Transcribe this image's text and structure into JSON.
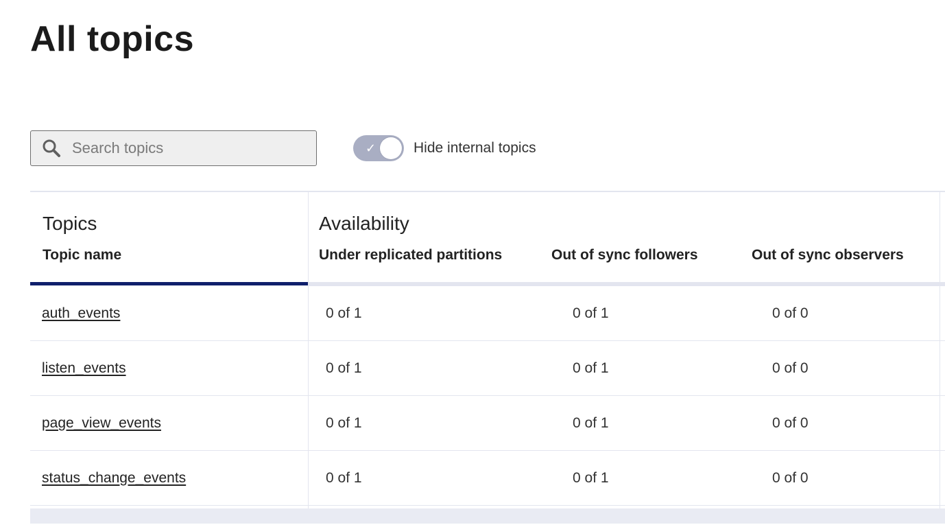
{
  "page": {
    "title": "All topics"
  },
  "search": {
    "placeholder": "Search topics",
    "value": ""
  },
  "toggle": {
    "label": "Hide internal topics",
    "checked": true
  },
  "table": {
    "groups": [
      {
        "title": "Topics"
      },
      {
        "title": "Availability"
      }
    ],
    "columns": [
      "Topic name",
      "Under replicated partitions",
      "Out of sync followers",
      "Out of sync observers"
    ],
    "rows": [
      {
        "name": "auth_events",
        "under_replicated": "0 of 1",
        "out_of_sync_followers": "0 of 1",
        "out_of_sync_observers": "0 of 0"
      },
      {
        "name": "listen_events",
        "under_replicated": "0 of 1",
        "out_of_sync_followers": "0 of 1",
        "out_of_sync_observers": "0 of 0"
      },
      {
        "name": "page_view_events",
        "under_replicated": "0 of 1",
        "out_of_sync_followers": "0 of 1",
        "out_of_sync_observers": "0 of 0"
      },
      {
        "name": "status_change_events",
        "under_replicated": "0 of 1",
        "out_of_sync_followers": "0 of 1",
        "out_of_sync_observers": "0 of 0"
      }
    ]
  },
  "colors": {
    "accent": "#0f1f6b",
    "toggle_track": "#a9aec3",
    "divider": "#e3e5ef"
  },
  "icons": {
    "search": "search-icon",
    "check": "check-icon"
  }
}
